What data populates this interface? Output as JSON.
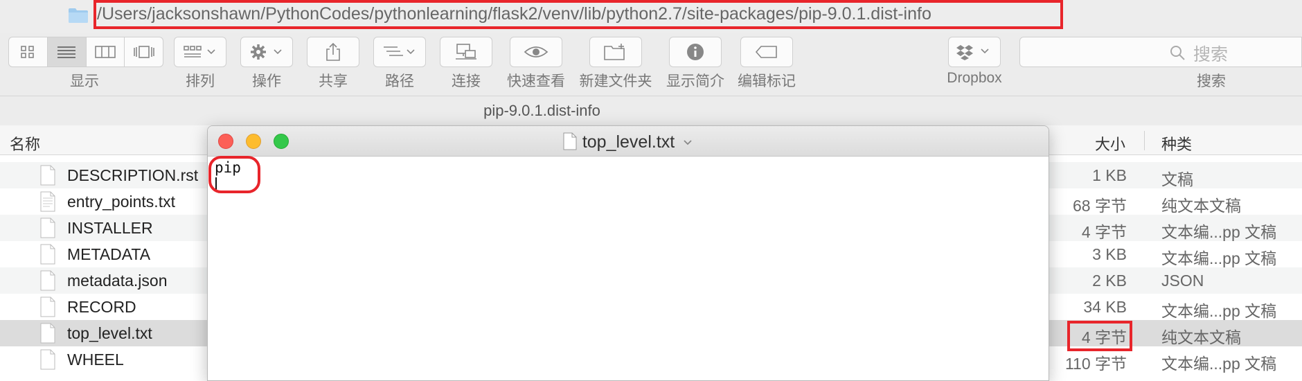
{
  "path": "/Users/jacksonshawn/PythonCodes/pythonlearning/flask2/venv/lib/python2.7/site-packages/pip-9.0.1.dist-info",
  "toolbar": {
    "view_label": "显示",
    "arrange_label": "排列",
    "action_label": "操作",
    "share_label": "共享",
    "path_label": "路径",
    "connect_label": "连接",
    "quicklook_label": "快速查看",
    "newfolder_label": "新建文件夹",
    "getinfo_label": "显示简介",
    "tags_label": "编辑标记",
    "dropbox_label": "Dropbox",
    "search_label": "搜索",
    "search_placeholder": "搜索"
  },
  "window_title": "pip-9.0.1.dist-info",
  "columns": {
    "name": "名称",
    "size": "大小",
    "kind": "种类"
  },
  "files": [
    {
      "name": "DESCRIPTION.rst",
      "size": "1 KB",
      "kind": "文稿"
    },
    {
      "name": "entry_points.txt",
      "size": "68 字节",
      "kind": "纯文本文稿"
    },
    {
      "name": "INSTALLER",
      "size": "4 字节",
      "kind": "文本编...pp 文稿"
    },
    {
      "name": "METADATA",
      "size": "3 KB",
      "kind": "文本编...pp 文稿"
    },
    {
      "name": "metadata.json",
      "size": "2 KB",
      "kind": "JSON"
    },
    {
      "name": "RECORD",
      "size": "34 KB",
      "kind": "文本编...pp 文稿"
    },
    {
      "name": "top_level.txt",
      "size": "4 字节",
      "kind": "纯文本文稿"
    },
    {
      "name": "WHEEL",
      "size": "110 字节",
      "kind": "文本编...pp 文稿"
    }
  ],
  "editor": {
    "title": "top_level.txt",
    "content": "pip"
  },
  "colors": {
    "highlight": "#e8252b",
    "close": "#fc5f57",
    "minimize": "#fdbc2e",
    "maximize": "#34c84a"
  }
}
